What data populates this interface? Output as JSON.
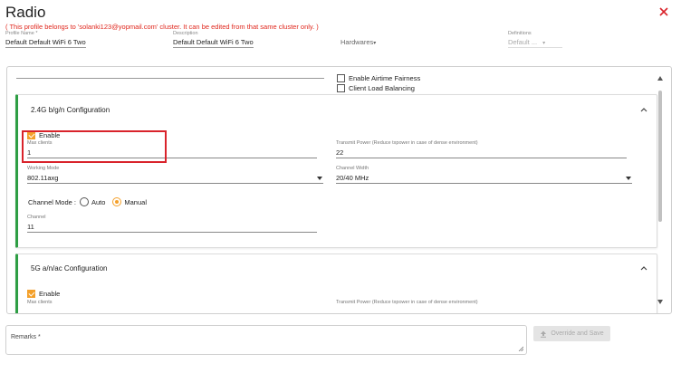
{
  "header": {
    "title": "Radio",
    "warning": "( This profile belongs to 'solanki123@yopmail.com' cluster. It can be edited from that same cluster only. )"
  },
  "profile_fields": {
    "profile_name": {
      "label": "Profile Name *",
      "value": "Default Default WiFi 6 Two Ra"
    },
    "description": {
      "label": "Description",
      "value": "Default Default WiFi 6 Two Ra"
    },
    "hardwares": {
      "label": "Hardwares"
    },
    "definitions": {
      "label": "Definitions",
      "value": "Default ..."
    }
  },
  "options": {
    "airtime_fairness": {
      "label": "Enable Airtime Fairness",
      "checked": false
    },
    "client_load_balancing": {
      "label": "Client Load Balancing",
      "checked": false
    }
  },
  "config_24": {
    "title": "2.4G b/g/n Configuration",
    "enable": {
      "label": "Enable",
      "checked": true
    },
    "max_clients": {
      "label": "Max clients",
      "value": "1"
    },
    "transmit_power": {
      "label": "Transmit Power (Reduce txpower in case of dense environment)",
      "value": "22"
    },
    "working_mode": {
      "label": "Working Mode",
      "value": "802.11axg"
    },
    "channel_width": {
      "label": "Channel Width",
      "value": "20/40 MHz"
    },
    "channel_mode": {
      "label": "Channel Mode :",
      "auto_label": "Auto",
      "manual_label": "Manual",
      "selected": "Manual"
    },
    "channel": {
      "label": "Channel",
      "value": "11"
    }
  },
  "config_5": {
    "title": "5G a/n/ac Configuration",
    "enable": {
      "label": "Enable",
      "checked": true
    },
    "max_clients": {
      "label": "Max clients"
    },
    "transmit_power": {
      "label": "Transmit Power (Reduce txpower in case of dense environment)"
    }
  },
  "footer": {
    "remarks_label": "Remarks *",
    "save_button_label": "Override and Save"
  },
  "colors": {
    "accent": "#f4a02a",
    "section_bar": "#2e9e44",
    "warning": "#e0281e",
    "highlight": "#d9232b"
  },
  "icons": [
    "close-icon",
    "chevron-up-icon",
    "dropdown-caret-icon",
    "upload-icon",
    "resize-grip-icon"
  ]
}
